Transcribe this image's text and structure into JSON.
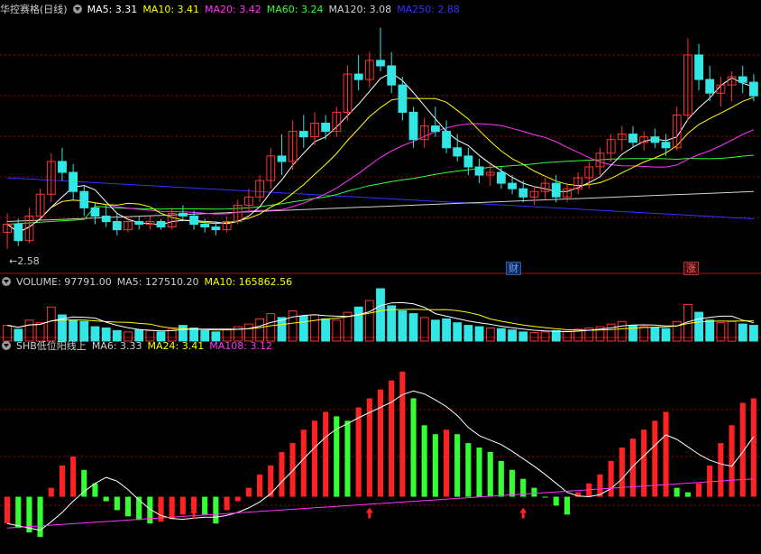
{
  "price_header": {
    "title": "华控赛格(日线)",
    "ma": [
      {
        "label": "MA5: 3.31",
        "color": "#ffffff"
      },
      {
        "label": "MA10: 3.41",
        "color": "#ffff00"
      },
      {
        "label": "MA20: 3.42",
        "color": "#ff33ff"
      },
      {
        "label": "MA60: 3.24",
        "color": "#33ff33"
      },
      {
        "label": "MA120: 3.08",
        "color": "#d0d0d0"
      },
      {
        "label": "MA250: 2.88",
        "color": "#3333ff"
      }
    ]
  },
  "volume_header": {
    "items": [
      {
        "label": "VOLUME: 97791.00",
        "color": "#d0d0d0"
      },
      {
        "label": "MA5: 127510.20",
        "color": "#d0d0d0"
      },
      {
        "label": "MA10: 165862.56",
        "color": "#ffff00"
      }
    ]
  },
  "indicator_header": {
    "items": [
      {
        "label": "SHB低位阳线上",
        "color": "#d0d0d0"
      },
      {
        "label": "MA6: 3.33",
        "color": "#d0d0d0"
      },
      {
        "label": "MA24: 3.41",
        "color": "#ffff00"
      },
      {
        "label": "MA108: 3.12",
        "color": "#ff33ff"
      }
    ]
  },
  "low_price_label": "2.58",
  "badges": [
    {
      "text": "财",
      "color": "#6fa0ff",
      "bg": "#113366"
    },
    {
      "text": "涨",
      "color": "#ff6666",
      "bg": "#551111"
    }
  ],
  "colors": {
    "up": "#ff3333",
    "down": "#33e6e6",
    "ind_up": "#ff2222",
    "ind_down": "#33ff33",
    "arrow": "#ff2222",
    "grid": "#aa0000"
  },
  "chart_data": [
    {
      "type": "candlestick",
      "title": "华控赛格(日线)",
      "ylim": [
        2.5,
        4.35
      ],
      "lowest_marker": 2.58,
      "ohlc": [
        [
          2.78,
          2.92,
          2.66,
          2.84
        ],
        [
          2.84,
          2.88,
          2.68,
          2.72
        ],
        [
          2.72,
          2.96,
          2.7,
          2.9
        ],
        [
          2.9,
          3.1,
          2.88,
          3.06
        ],
        [
          3.06,
          3.36,
          3.0,
          3.3
        ],
        [
          3.3,
          3.4,
          3.16,
          3.22
        ],
        [
          3.22,
          3.28,
          3.02,
          3.08
        ],
        [
          3.08,
          3.12,
          2.9,
          2.96
        ],
        [
          2.96,
          3.0,
          2.84,
          2.9
        ],
        [
          2.9,
          2.98,
          2.82,
          2.86
        ],
        [
          2.86,
          2.92,
          2.76,
          2.8
        ],
        [
          2.8,
          2.9,
          2.78,
          2.86
        ],
        [
          2.86,
          2.9,
          2.8,
          2.84
        ],
        [
          2.84,
          2.9,
          2.8,
          2.86
        ],
        [
          2.86,
          2.88,
          2.8,
          2.82
        ],
        [
          2.82,
          2.96,
          2.8,
          2.92
        ],
        [
          2.92,
          2.98,
          2.86,
          2.9
        ],
        [
          2.9,
          2.94,
          2.8,
          2.84
        ],
        [
          2.84,
          2.88,
          2.78,
          2.82
        ],
        [
          2.82,
          2.86,
          2.76,
          2.8
        ],
        [
          2.8,
          2.9,
          2.78,
          2.86
        ],
        [
          2.86,
          3.02,
          2.84,
          2.98
        ],
        [
          2.98,
          3.1,
          2.92,
          3.04
        ],
        [
          3.04,
          3.2,
          3.0,
          3.16
        ],
        [
          3.16,
          3.4,
          3.1,
          3.34
        ],
        [
          3.34,
          3.5,
          3.2,
          3.3
        ],
        [
          3.3,
          3.6,
          3.24,
          3.52
        ],
        [
          3.52,
          3.64,
          3.4,
          3.48
        ],
        [
          3.48,
          3.66,
          3.42,
          3.58
        ],
        [
          3.58,
          3.64,
          3.46,
          3.52
        ],
        [
          3.52,
          3.7,
          3.48,
          3.66
        ],
        [
          3.66,
          4.0,
          3.6,
          3.94
        ],
        [
          3.94,
          4.08,
          3.82,
          3.9
        ],
        [
          3.9,
          4.1,
          3.84,
          4.04
        ],
        [
          4.04,
          4.28,
          3.96,
          4.0
        ],
        [
          4.0,
          4.1,
          3.8,
          3.86
        ],
        [
          3.86,
          3.92,
          3.6,
          3.66
        ],
        [
          3.66,
          3.7,
          3.4,
          3.46
        ],
        [
          3.46,
          3.62,
          3.4,
          3.56
        ],
        [
          3.56,
          3.7,
          3.48,
          3.52
        ],
        [
          3.52,
          3.6,
          3.36,
          3.4
        ],
        [
          3.4,
          3.5,
          3.3,
          3.34
        ],
        [
          3.34,
          3.4,
          3.2,
          3.26
        ],
        [
          3.26,
          3.32,
          3.14,
          3.2
        ],
        [
          3.2,
          3.28,
          3.12,
          3.22
        ],
        [
          3.22,
          3.26,
          3.1,
          3.14
        ],
        [
          3.14,
          3.2,
          3.06,
          3.1
        ],
        [
          3.1,
          3.16,
          3.0,
          3.04
        ],
        [
          3.04,
          3.12,
          2.98,
          3.08
        ],
        [
          3.08,
          3.18,
          3.02,
          3.14
        ],
        [
          3.14,
          3.2,
          3.0,
          3.04
        ],
        [
          3.04,
          3.14,
          3.0,
          3.1
        ],
        [
          3.1,
          3.22,
          3.06,
          3.18
        ],
        [
          3.18,
          3.3,
          3.1,
          3.26
        ],
        [
          3.26,
          3.4,
          3.2,
          3.36
        ],
        [
          3.36,
          3.5,
          3.3,
          3.46
        ],
        [
          3.46,
          3.56,
          3.38,
          3.5
        ],
        [
          3.5,
          3.56,
          3.4,
          3.44
        ],
        [
          3.44,
          3.52,
          3.38,
          3.48
        ],
        [
          3.48,
          3.54,
          3.4,
          3.44
        ],
        [
          3.44,
          3.5,
          3.34,
          3.4
        ],
        [
          3.4,
          3.7,
          3.38,
          3.64
        ],
        [
          3.64,
          4.2,
          3.6,
          4.08
        ],
        [
          4.08,
          4.16,
          3.82,
          3.9
        ],
        [
          3.9,
          4.0,
          3.74,
          3.8
        ],
        [
          3.8,
          3.92,
          3.7,
          3.86
        ],
        [
          3.86,
          3.96,
          3.74,
          3.92
        ],
        [
          3.92,
          4.0,
          3.8,
          3.88
        ],
        [
          3.88,
          3.94,
          3.74,
          3.78
        ]
      ],
      "series": [
        {
          "name": "MA5",
          "color": "#ffffff"
        },
        {
          "name": "MA10",
          "color": "#ffff00"
        },
        {
          "name": "MA20",
          "color": "#ff33ff"
        },
        {
          "name": "MA60",
          "color": "#33ff33"
        },
        {
          "name": "MA120",
          "color": "#d0d0d0"
        },
        {
          "name": "MA250",
          "color": "#3333ff"
        }
      ]
    },
    {
      "type": "bar",
      "title": "VOLUME",
      "ylim": [
        0,
        400000
      ],
      "values": [
        120000,
        90000,
        160000,
        140000,
        260000,
        200000,
        160000,
        150000,
        110000,
        100000,
        80000,
        70000,
        85000,
        80000,
        70000,
        90000,
        120000,
        100000,
        80000,
        70000,
        90000,
        110000,
        130000,
        170000,
        210000,
        180000,
        230000,
        190000,
        200000,
        170000,
        160000,
        220000,
        260000,
        310000,
        400000,
        270000,
        230000,
        210000,
        180000,
        160000,
        170000,
        140000,
        120000,
        110000,
        100000,
        95000,
        85000,
        70000,
        65000,
        70000,
        80000,
        75000,
        90000,
        100000,
        110000,
        130000,
        150000,
        120000,
        110000,
        100000,
        95000,
        150000,
        280000,
        220000,
        160000,
        140000,
        150000,
        130000,
        120000
      ],
      "series": [
        {
          "name": "MA5",
          "color": "#ffffff"
        },
        {
          "name": "MA10",
          "color": "#ffff00"
        }
      ]
    },
    {
      "type": "bar",
      "title": "SHB低位阳线上",
      "ylim": [
        -0.6,
        1.6
      ],
      "values": [
        -0.3,
        -0.35,
        -0.4,
        -0.45,
        0.1,
        0.35,
        0.45,
        0.3,
        0.15,
        -0.05,
        -0.15,
        -0.22,
        -0.26,
        -0.3,
        -0.28,
        -0.25,
        -0.2,
        -0.15,
        -0.2,
        -0.3,
        -0.15,
        -0.05,
        0.1,
        0.25,
        0.35,
        0.5,
        0.6,
        0.75,
        0.85,
        0.95,
        0.9,
        0.85,
        1.0,
        1.1,
        1.2,
        1.3,
        1.4,
        1.1,
        0.8,
        0.7,
        0.75,
        0.7,
        0.6,
        0.55,
        0.5,
        0.4,
        0.3,
        0.2,
        0.1,
        0.0,
        -0.1,
        -0.2,
        0.05,
        0.15,
        0.25,
        0.4,
        0.55,
        0.65,
        0.75,
        0.85,
        0.95,
        0.1,
        0.05,
        0.15,
        0.35,
        0.6,
        0.8,
        1.05,
        1.1
      ],
      "series": [
        {
          "name": "MA6",
          "color": "#ffffff"
        },
        {
          "name": "MA24",
          "color": "#ffff00"
        },
        {
          "name": "MA108",
          "color": "#ff33ff"
        }
      ]
    }
  ]
}
